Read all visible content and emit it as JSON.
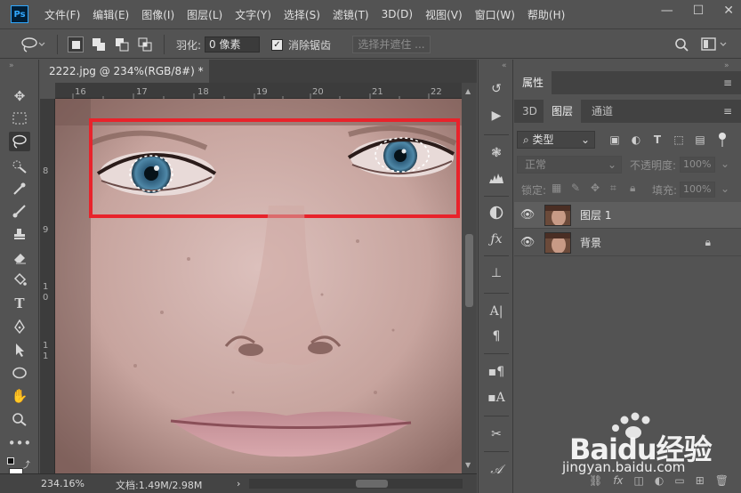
{
  "app": {
    "logo_text": "Ps"
  },
  "menu": {
    "items": [
      "文件(F)",
      "编辑(E)",
      "图像(I)",
      "图层(L)",
      "文字(Y)",
      "选择(S)",
      "滤镜(T)",
      "3D(D)",
      "视图(V)",
      "窗口(W)",
      "帮助(H)"
    ]
  },
  "window_controls": {
    "minimize": "—",
    "maximize": "☐",
    "close": "✕"
  },
  "options_bar": {
    "feather_label": "羽化:",
    "feather_value": "0 像素",
    "antialias_label": "消除锯齿",
    "antialias_checked": true,
    "select_and_mask_label": "选择并遮住 ..."
  },
  "document": {
    "tab_title": "2222.jpg @ 234%(RGB/8#) *",
    "tab_close": "×",
    "ruler_top_ticks": [
      "16",
      "17",
      "18",
      "19",
      "20",
      "21",
      "22"
    ],
    "ruler_left_ticks": [
      "8",
      "9",
      "1",
      "0",
      "1",
      "1"
    ]
  },
  "status_bar": {
    "zoom": "234.16%",
    "doc_info": "文档:1.49M/2.98M",
    "arrow": "›"
  },
  "panels": {
    "properties_title": "属性",
    "tabs": [
      "3D",
      "图层",
      "通道"
    ],
    "active_tab": "图层",
    "filter_type": "类型",
    "blend_mode": "正常",
    "opacity_label": "不透明度:",
    "opacity_value": "100%",
    "lock_label": "锁定:",
    "fill_label": "填充:",
    "fill_value": "100%",
    "layers": [
      {
        "name": "图层 1",
        "locked": false
      },
      {
        "name": "背景",
        "locked": true
      }
    ],
    "footer_fx": "fx"
  },
  "watermark": {
    "brand": "Baidu经验",
    "url": "jingyan.baidu.com"
  },
  "colors": {
    "ui_bg": "#535353",
    "selection_highlight": "#e8232b",
    "ps_blue": "#31a8ff"
  }
}
